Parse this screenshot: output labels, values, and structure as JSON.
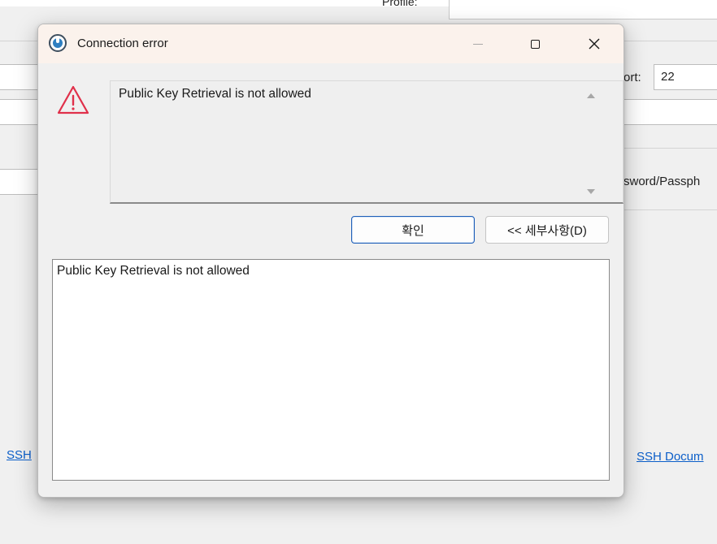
{
  "background": {
    "profile_label": "Profile:",
    "port_label": "ort:",
    "port_value": "22",
    "password_label": "sword/Passph",
    "ssh_link_left": "SSH",
    "ssh_link_right": "SSH Docum"
  },
  "dialog": {
    "title": "Connection error",
    "message": "Public Key Retrieval is not allowed",
    "ok_label": "확인",
    "details_label": "<< 세부사항(D)",
    "details_text": "Public Key Retrieval is not allowed"
  },
  "colors": {
    "warning_red": "#e0304a",
    "accent_blue": "#1f5fb8",
    "link_blue": "#0b5ec9"
  },
  "icons": {
    "app": "dbeaver-icon",
    "warning": "warning-triangle-icon",
    "minimize": "minimize-icon",
    "maximize": "maximize-icon",
    "close": "close-icon"
  }
}
